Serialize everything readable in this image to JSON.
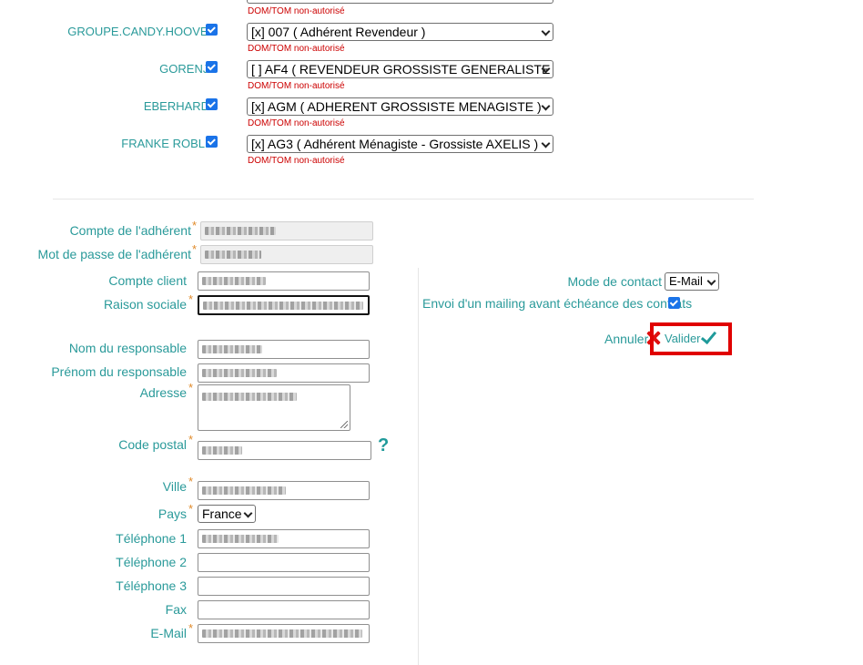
{
  "brands": [
    {
      "name": "GROUPE.CANDY.HOOVER",
      "select": "[x] 007 ( Adhérent Revendeur )",
      "error": "DOM/TOM non-autorisé"
    },
    {
      "name": "GORENJE",
      "select": "[ ] AF4 ( REVENDEUR GROSSISTE GENERALISTE",
      "error": "DOM/TOM non-autorisé"
    },
    {
      "name": "EBERHARDT",
      "select": "[x] AGM ( ADHERENT GROSSISTE MENAGISTE )",
      "error": "DOM/TOM non-autorisé"
    },
    {
      "name": "FRANKE ROBLIN",
      "select": "[x] AG3 ( Adhérent Ménagiste - Grossiste AXELIS )",
      "error": "DOM/TOM non-autorisé"
    }
  ],
  "top_error": "DOM/TOM non-autorisé",
  "form": {
    "compte_adherent": "Compte de l'adhérent",
    "mot_de_passe": "Mot de passe de l'adhérent",
    "compte_client": "Compte client",
    "raison_sociale": "Raison sociale",
    "nom_responsable": "Nom du responsable",
    "prenom_responsable": "Prénom du responsable",
    "adresse": "Adresse",
    "code_postal": "Code postal",
    "ville": "Ville",
    "pays": "Pays",
    "pays_value": "France",
    "telephone1": "Téléphone 1",
    "telephone2": "Téléphone 2",
    "telephone3": "Téléphone 3",
    "fax": "Fax",
    "email": "E-Mail",
    "required_mark": "*",
    "help": "?"
  },
  "right": {
    "mode_contact_label": "Mode de contact",
    "mode_contact_value": "E-Mail",
    "mailing_label": "Envoi d'un mailing avant échéance des contrats",
    "annuler": "Annuler",
    "valider": "Valider"
  }
}
